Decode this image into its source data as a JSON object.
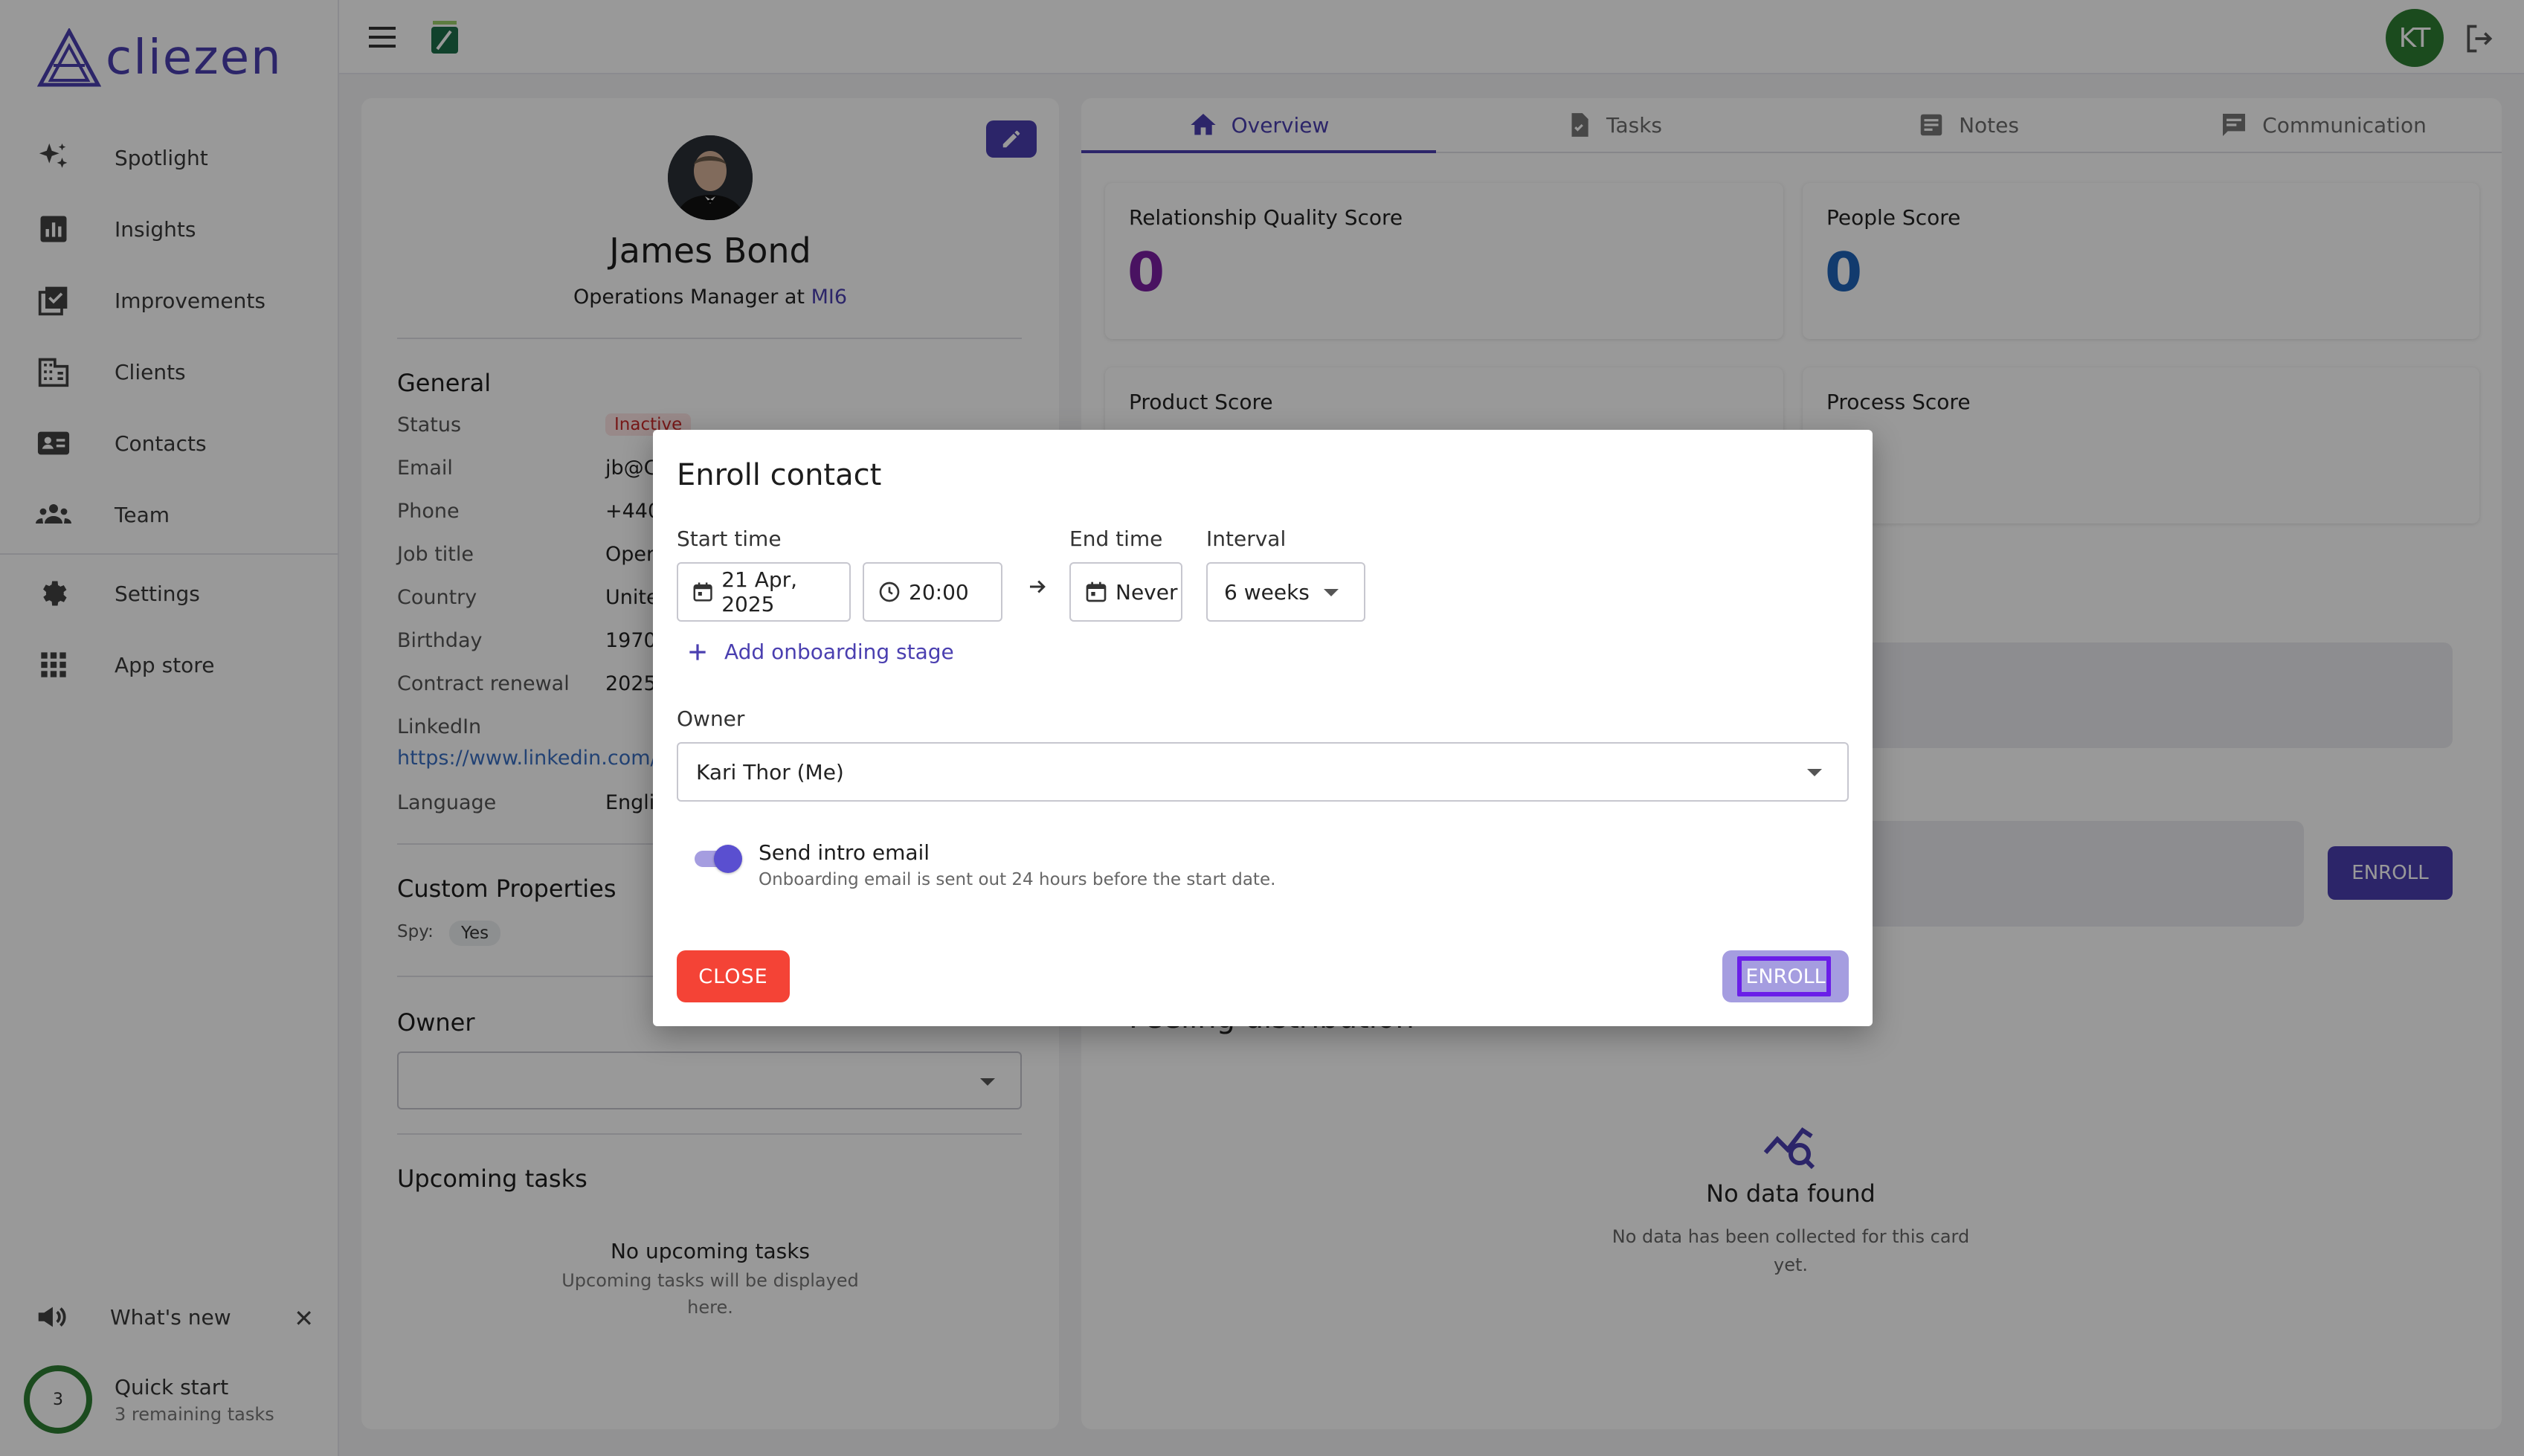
{
  "brand": {
    "name": "cliezen",
    "accent": "#4a3fb0"
  },
  "sidebar": {
    "items": [
      {
        "label": "Spotlight",
        "icon": "sparkle-icon"
      },
      {
        "label": "Insights",
        "icon": "bar-chart-icon"
      },
      {
        "label": "Improvements",
        "icon": "checklist-icon"
      },
      {
        "label": "Clients",
        "icon": "building-icon"
      },
      {
        "label": "Contacts",
        "icon": "contact-card-icon"
      },
      {
        "label": "Team",
        "icon": "team-icon"
      }
    ],
    "items2": [
      {
        "label": "Settings",
        "icon": "gear-icon"
      },
      {
        "label": "App store",
        "icon": "apps-grid-icon"
      }
    ],
    "whats_new": "What's new",
    "close_symbol": "✕",
    "quick_start": {
      "count": "3",
      "title": "Quick start",
      "subtitle": "3 remaining tasks"
    }
  },
  "topbar": {
    "avatar_initials": "KT"
  },
  "profile": {
    "name": "James Bond",
    "role_prefix": "Operations Manager at ",
    "company": "MI6",
    "general_title": "General",
    "fields": [
      {
        "label": "Status",
        "value": "Inactive"
      },
      {
        "label": "Email",
        "value": "jb@C"
      },
      {
        "label": "Phone",
        "value": "+440"
      },
      {
        "label": "Job title",
        "value": "Oper"
      },
      {
        "label": "Country",
        "value": "Unite"
      },
      {
        "label": "Birthday",
        "value": "1970,"
      },
      {
        "label": "Contract renewal",
        "value": "2025"
      },
      {
        "label": "LinkedIn",
        "value": "https://www.linkedin.com/i"
      },
      {
        "label": "Language",
        "value": "Engli"
      }
    ],
    "custom_title": "Custom Properties",
    "custom_spy_label": "Spy:",
    "custom_spy_value": "Yes",
    "owner_title": "Owner",
    "upcoming_title": "Upcoming tasks",
    "upcoming_empty_title": "No upcoming tasks",
    "upcoming_empty_line1": "Upcoming tasks will be displayed",
    "upcoming_empty_line2": "here."
  },
  "tabs": [
    {
      "label": "Overview",
      "icon": "home-icon",
      "active": true
    },
    {
      "label": "Tasks",
      "icon": "task-file-icon",
      "active": false
    },
    {
      "label": "Notes",
      "icon": "notes-icon",
      "active": false
    },
    {
      "label": "Communication",
      "icon": "chat-icon",
      "active": false
    }
  ],
  "scores": [
    {
      "title": "Relationship Quality Score",
      "value": "0",
      "color": "#7b1fa2"
    },
    {
      "title": "People Score",
      "value": "0",
      "color": "#1e63b8"
    },
    {
      "title": "Product Score",
      "value": ""
    },
    {
      "title": "Process Score",
      "value": ""
    }
  ],
  "overview": {
    "enroll_label": "ENROLL",
    "feeling_title": "Feeling distribution",
    "no_data_title": "No data found",
    "no_data_line1": "No data has been collected for this card",
    "no_data_line2": "yet."
  },
  "modal": {
    "title": "Enroll contact",
    "start_label": "Start time",
    "start_date": "21 Apr, 2025",
    "start_time": "20:00",
    "end_label": "End time",
    "end_value": "Never",
    "interval_label": "Interval",
    "interval_value": "6 weeks",
    "add_stage": "Add onboarding stage",
    "owner_label": "Owner",
    "owner_value": "Kari Thor (Me)",
    "intro_toggle_on": true,
    "intro_label": "Send intro email",
    "intro_sub": "Onboarding email is sent out 24 hours before the start date.",
    "close_label": "CLOSE",
    "enroll_label": "ENROLL"
  }
}
